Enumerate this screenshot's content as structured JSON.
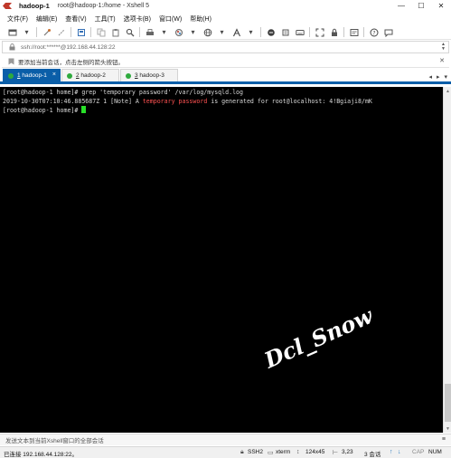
{
  "window": {
    "session_name": "hadoop-1",
    "title_path": "root@hadoop-1:/home - Xshell 5",
    "minimize": "—",
    "maximize": "☐",
    "close": "✕"
  },
  "menu": [
    "文件(F)",
    "编辑(E)",
    "查看(V)",
    "工具(T)",
    "选项卡(B)",
    "窗口(W)",
    "帮助(H)"
  ],
  "address": {
    "text": "ssh://root:******@192.168.44.128:22"
  },
  "info_bar": {
    "text": "要添加当前会话，点击左侧的箭头按钮。"
  },
  "tabs": [
    {
      "num": "1",
      "label": " hadoop-1",
      "active": true
    },
    {
      "num": "2",
      "label": " hadoop-2",
      "active": false
    },
    {
      "num": "3",
      "label": " hadoop-3",
      "active": false
    }
  ],
  "terminal": {
    "line1": "[root@hadoop-1 home]# grep 'temporary password' /var/log/mysqld.log",
    "line2_prefix": "2019-10-30T07:10:46.885687Z 1 [Note] A ",
    "line2_highlight": "temporary password",
    "line2_suffix": " is generated for root@localhost: 4!Bgiaji8/mK",
    "line3": "[root@hadoop-1 home]# ",
    "watermark": "Dcl_Snow",
    "cursor_color": "#28e028",
    "highlight_color": "#ff5252"
  },
  "compose_bar": {
    "text": "发送文本到当前Xshell窗口的全部会话"
  },
  "status": {
    "connected": "已连接 192.168.44.128:22。",
    "protocol": "SSH2",
    "terminal_type": "xterm",
    "size": "124x45",
    "cursor_pos": "3,23",
    "sessions": "3 会话",
    "caps": "CAP",
    "num": "NUM"
  },
  "colors": {
    "accent": "#0a5ea8",
    "session_active": "#2eaa3e"
  }
}
